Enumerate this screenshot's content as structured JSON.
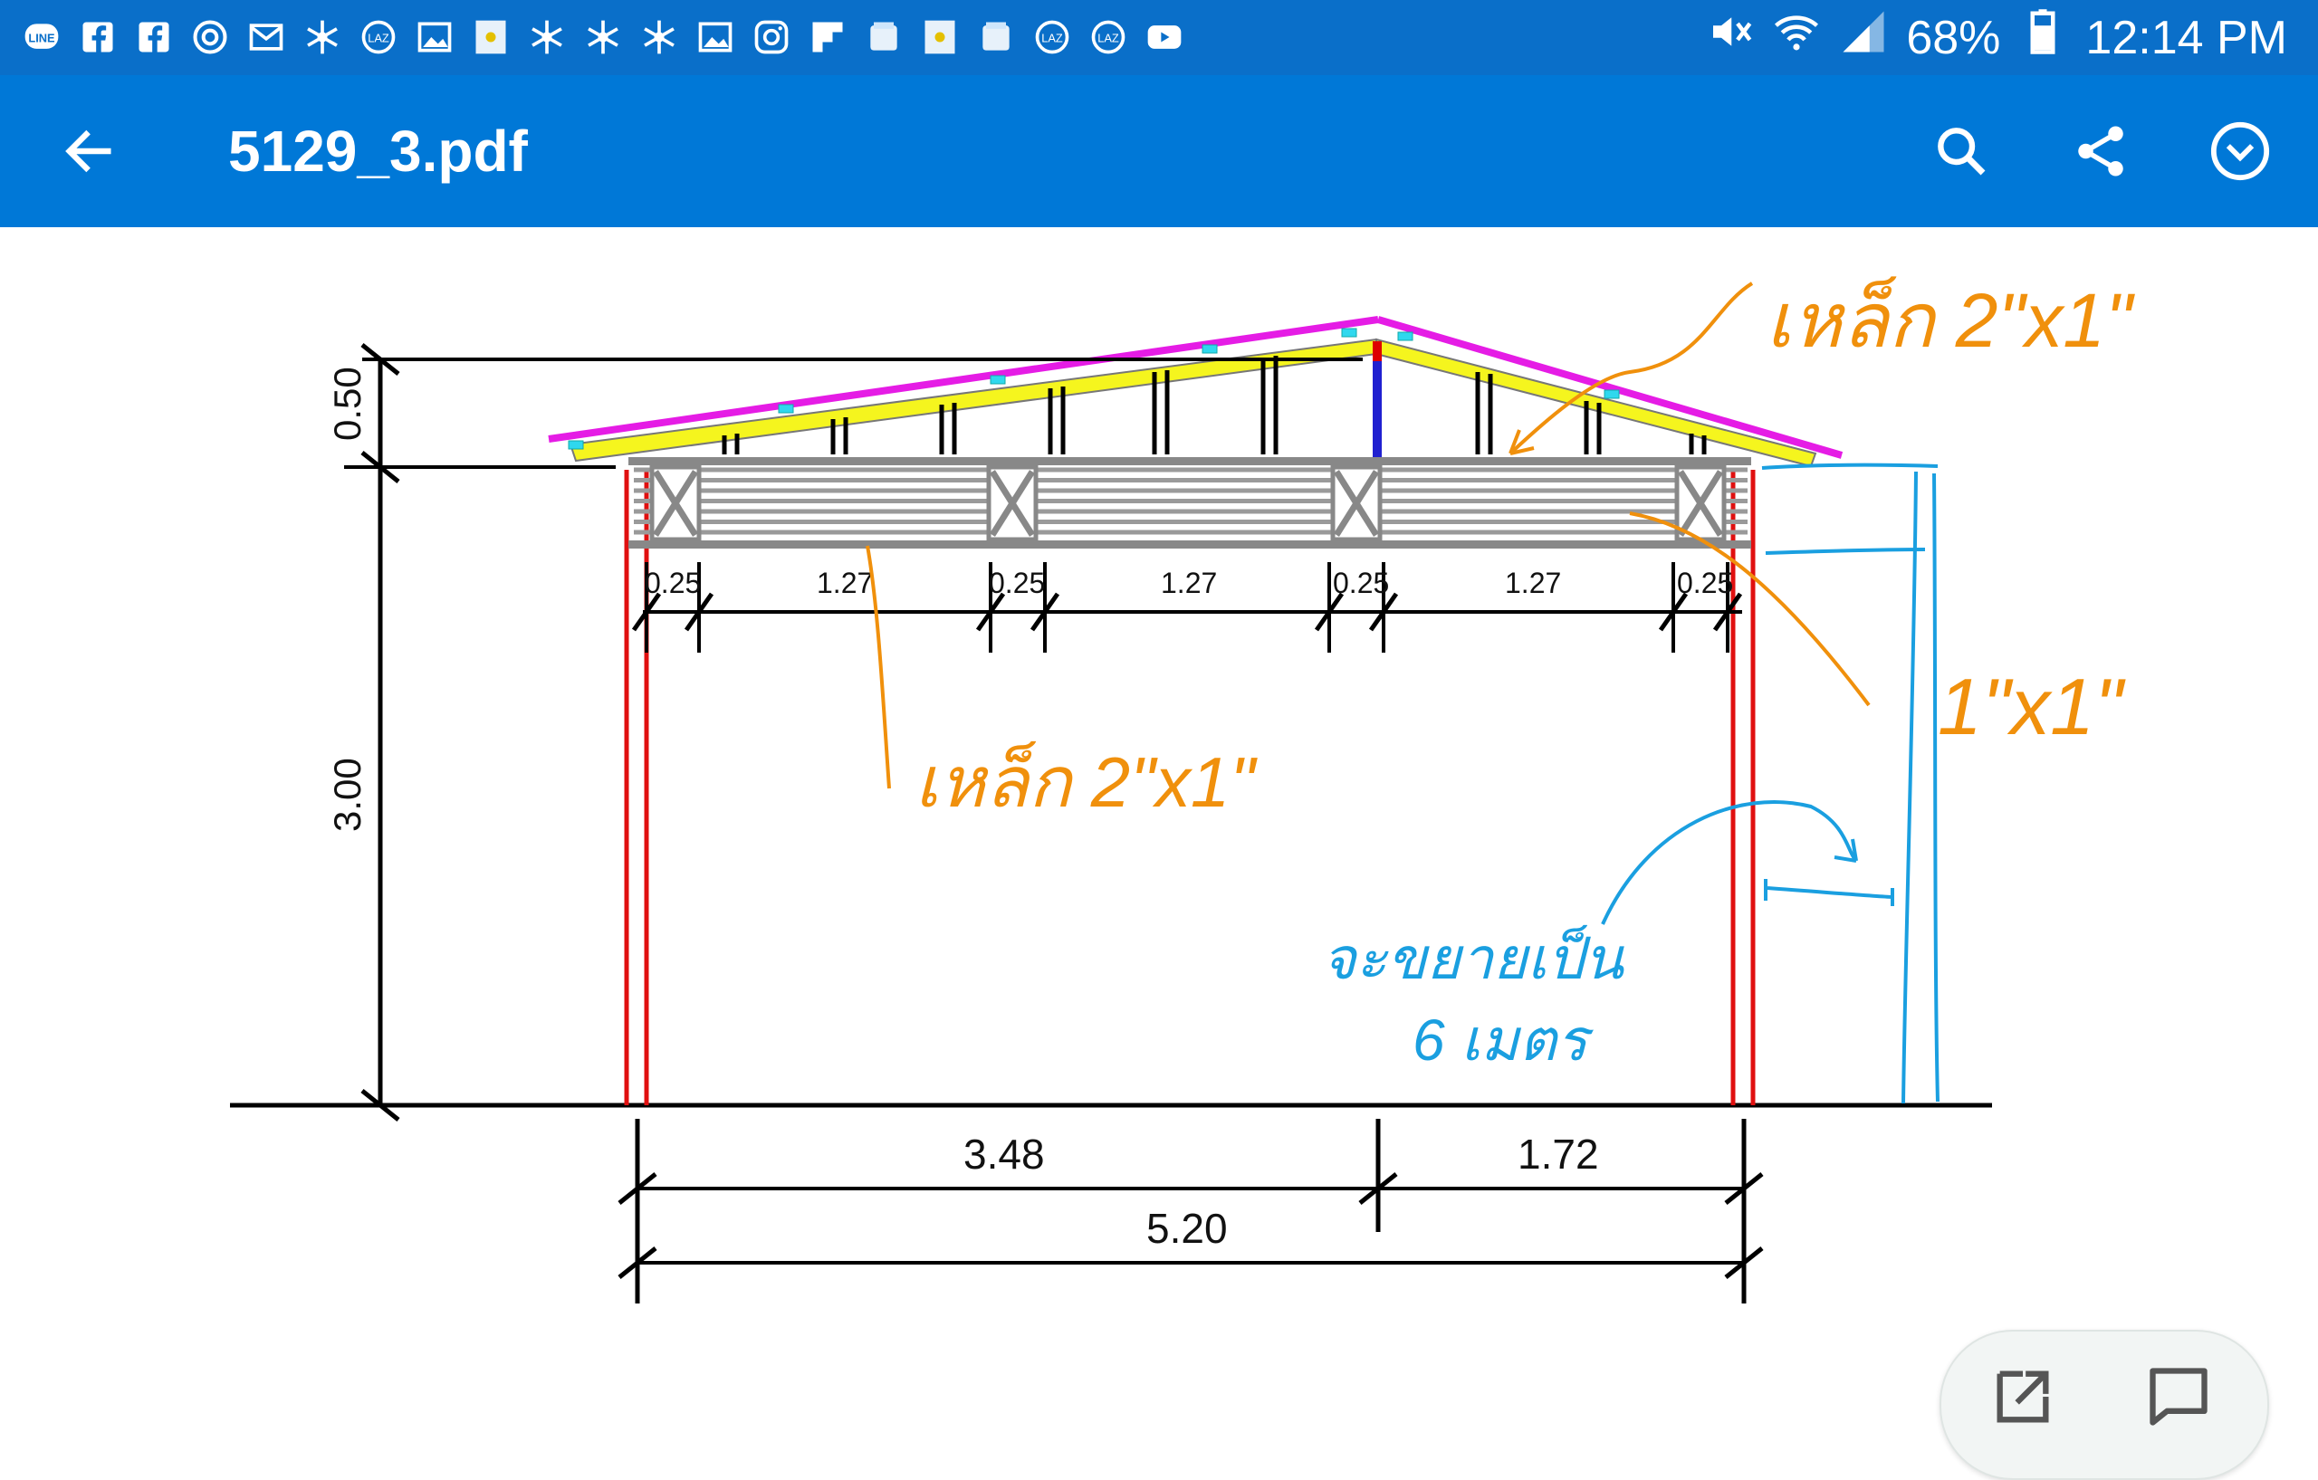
{
  "status_bar": {
    "notification_icons": [
      "line-icon",
      "facebook-icon",
      "facebook-icon",
      "sync-icon",
      "mail-icon",
      "snowflake-icon",
      "lazada-icon",
      "gallery-icon",
      "galaxy-rewards-icon",
      "snowflake-icon",
      "snowflake-icon",
      "snowflake-icon",
      "gallery-icon",
      "instagram-icon",
      "flipboard-icon",
      "galaxy-app-icon",
      "galaxy-rewards-icon",
      "galaxy-app-icon",
      "lazada-icon",
      "lazada-icon",
      "youtube-icon"
    ],
    "battery": "68%",
    "time": "12:14 PM"
  },
  "app_bar": {
    "title": "5129_3.pdf"
  },
  "drawing": {
    "dimensions": {
      "roof_height": "0.50",
      "wall_height": "3.00",
      "gap_1": "0.25",
      "span_1": "1.27",
      "gap_2": "0.25",
      "span_2": "1.27",
      "gap_3": "0.25",
      "span_3": "1.27",
      "gap_4": "0.25",
      "left_segment": "3.48",
      "right_segment": "1.72",
      "total_width": "5.20"
    },
    "annotations": {
      "rafter_note_top": "เหล็ก 2\"x1\"",
      "beam_note": "เหล็ก 2\"x1\"",
      "blue_side_note": "1\"x1\"",
      "extend_note_line1": "จะขยายเป็น",
      "extend_note_line2": "6 เมตร"
    },
    "colors": {
      "roof_sheet": "#e51ce5",
      "rafter": "#f5f51e",
      "post": "#e01010",
      "ridge_post": "#2020d0",
      "handwritten_orange": "#f0900c",
      "handwritten_blue": "#1a9fe0"
    }
  },
  "bottom_actions": {
    "open_icon": "open-external-icon",
    "comment_icon": "comment-icon"
  }
}
